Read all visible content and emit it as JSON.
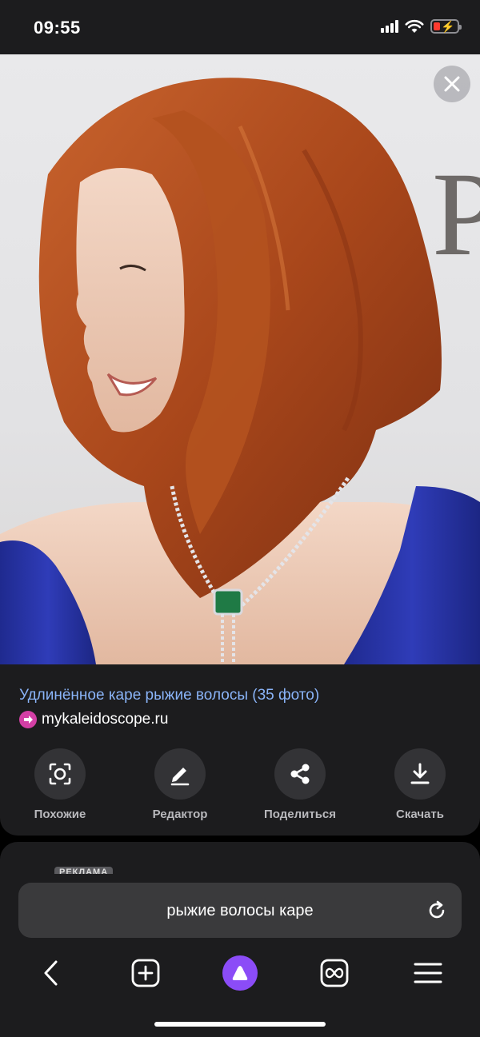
{
  "status_bar": {
    "time": "09:55"
  },
  "image_result": {
    "title": "Удлинённое каре рыжие волосы (35 фото)",
    "source": "mykaleidoscope.ru"
  },
  "actions": [
    {
      "label": "Похожие",
      "icon": "lens-scan-icon"
    },
    {
      "label": "Редактор",
      "icon": "pencil-icon"
    },
    {
      "label": "Поделиться",
      "icon": "share-icon"
    },
    {
      "label": "Скачать",
      "icon": "download-icon"
    }
  ],
  "ad": {
    "badge": "РЕКЛАМА"
  },
  "search": {
    "query": "рыжие волосы каре"
  },
  "colors": {
    "link": "#8ab4f8",
    "alice_purple": "#8b4cf7",
    "battery_low": "#ff3b30"
  }
}
